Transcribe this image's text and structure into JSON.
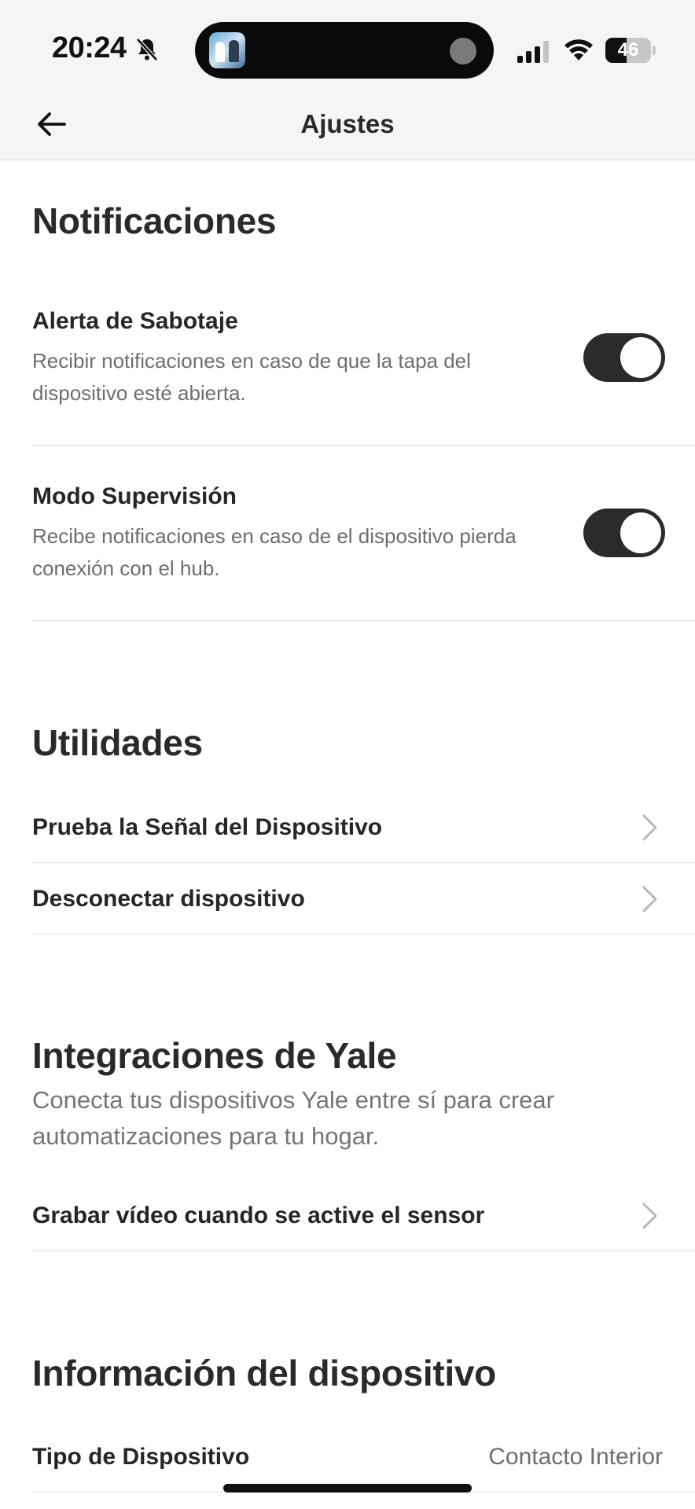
{
  "status_bar": {
    "time": "20:24",
    "battery_percent": "46",
    "battery_level": 0.46,
    "icons": [
      "bell-slash-icon",
      "signal-icon",
      "wifi-icon",
      "battery-icon"
    ]
  },
  "header": {
    "title": "Ajustes",
    "back_icon": "arrow-left-icon"
  },
  "notifications": {
    "title": "Notificaciones",
    "items": [
      {
        "title": "Alerta de Sabotaje",
        "description": "Recibir notificaciones en caso de que la tapa del dispositivo esté abierta.",
        "enabled": true
      },
      {
        "title": "Modo Supervisión",
        "description": "Recibe notificaciones en caso de el dispositivo pierda conexión con el hub.",
        "enabled": true
      }
    ]
  },
  "utilities": {
    "title": "Utilidades",
    "items": [
      {
        "label": "Prueba la Señal del Dispositivo"
      },
      {
        "label": "Desconectar dispositivo"
      }
    ]
  },
  "integrations": {
    "title": "Integraciones de Yale",
    "description": "Conecta tus dispositivos Yale entre sí para crear automatizaciones para tu hogar.",
    "items": [
      {
        "label": "Grabar vídeo cuando se active el sensor"
      }
    ]
  },
  "device_info": {
    "title": "Información del dispositivo",
    "rows": [
      {
        "label": "Tipo de Dispositivo",
        "value": "Contacto Interior"
      }
    ]
  },
  "colors": {
    "toggle_on": "#2b2b2b",
    "header_bg": "#f5f5f5",
    "text_primary": "#262626",
    "text_secondary": "#6e6e6e"
  }
}
